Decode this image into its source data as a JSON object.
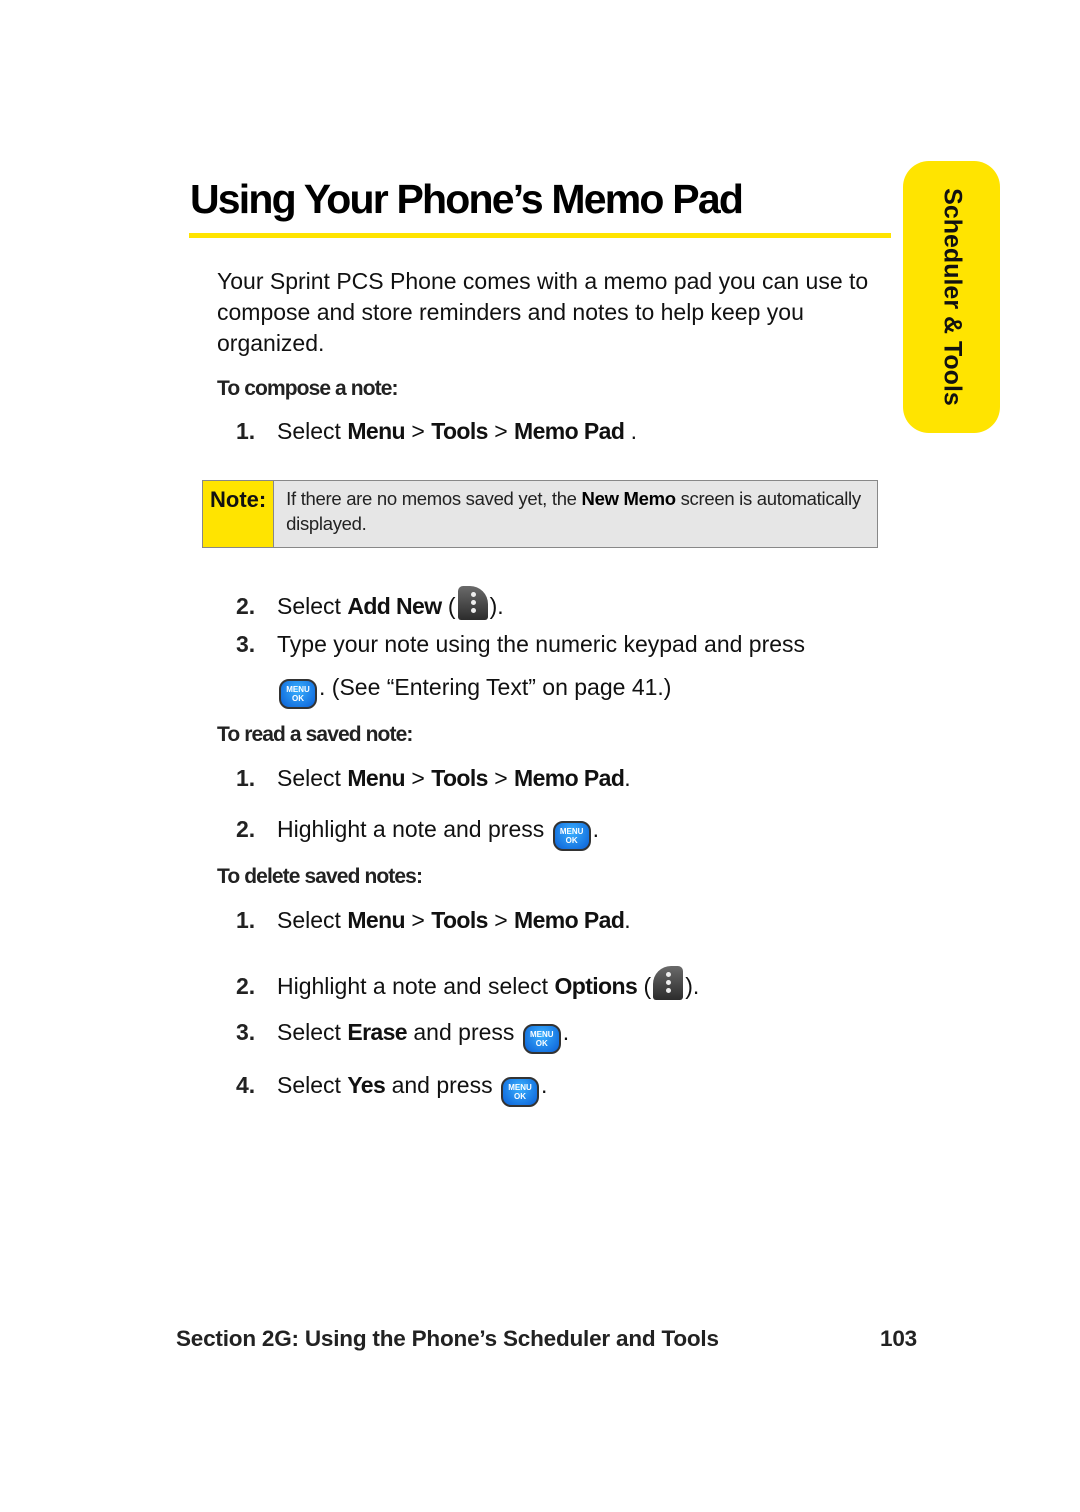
{
  "page": {
    "title": "Using Your Phone’s Memo Pad",
    "side_tab": "Scheduler & Tools",
    "intro": "Your Sprint PCS Phone comes with a memo pad you can use to compose and store reminders and notes to help keep you organized.",
    "accent_color": "#ffe400"
  },
  "compose": {
    "heading": "To compose a note:",
    "step1": {
      "num": "1.",
      "pre": "Select ",
      "menu": "Menu",
      "sep1": " > ",
      "tools": "Tools",
      "sep2": " > ",
      "memo": "Memo Pad",
      "post": " ."
    },
    "note": {
      "label": "Note:",
      "pre": "If there are no memos saved yet, the ",
      "bold": "New Memo",
      "post": " screen is automatically displayed."
    },
    "step2": {
      "num": "2.",
      "pre": "Select ",
      "bold": "Add New",
      "open": " (",
      "icon": "left-softkey-icon",
      "close": ")."
    },
    "step3": {
      "num": "3.",
      "line1": "Type your note using the numeric keypad and press",
      "icon": "menu-ok-key-icon",
      "line2": ". (See “Entering Text” on page 41.)"
    }
  },
  "read": {
    "heading": "To read a saved note:",
    "step1": {
      "num": "1.",
      "pre": "Select ",
      "menu": "Menu",
      "sep1": " > ",
      "tools": "Tools",
      "sep2": " > ",
      "memo": "Memo Pad",
      "post": "."
    },
    "step2": {
      "num": "2.",
      "pre": "Highlight a note and press ",
      "icon": "menu-ok-key-icon",
      "post": "."
    }
  },
  "delete": {
    "heading": "To delete saved notes:",
    "step1": {
      "num": "1.",
      "pre": "Select ",
      "menu": "Menu",
      "sep1": " > ",
      "tools": "Tools",
      "sep2": " > ",
      "memo": "Memo Pad",
      "post": "."
    },
    "step2": {
      "num": "2.",
      "pre": "Highlight a note and select ",
      "bold": "Options",
      "open": " (",
      "icon": "right-softkey-icon",
      "close": ")."
    },
    "step3": {
      "num": "3.",
      "pre": "Select ",
      "bold": "Erase",
      "mid": " and press ",
      "icon": "menu-ok-key-icon",
      "post": "."
    },
    "step4": {
      "num": "4.",
      "pre": "Select ",
      "bold": "Yes",
      "mid": " and press ",
      "icon": "menu-ok-key-icon",
      "post": "."
    }
  },
  "key": {
    "menu": "MENU",
    "ok": "OK"
  },
  "footer": {
    "section": "Section 2G: Using the Phone’s Scheduler and Tools",
    "page_number": "103"
  }
}
